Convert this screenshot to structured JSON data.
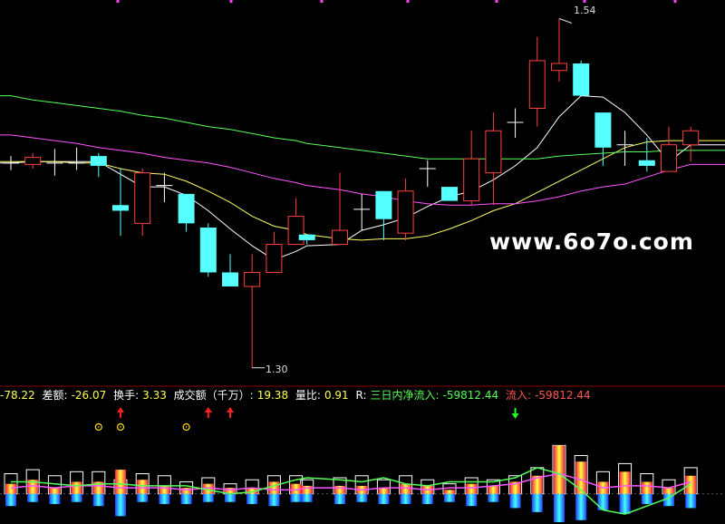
{
  "watermark": "www.6o7o.com",
  "annotations": {
    "high": "1.54",
    "low": "1.30"
  },
  "info_bar": {
    "item0_value": "-78.22",
    "item1_label": "差额:",
    "item1_value": "-26.07",
    "item2_label": "换手:",
    "item2_value": "3.33",
    "item3_label": "成交额（千万）:",
    "item3_value": "19.38",
    "item4_label": "量比:",
    "item4_value": "0.91",
    "item5_label": "R:",
    "item5_text": "三日内净流入:",
    "item5_value": "-59812.44",
    "item6_text": "流入:",
    "item6_value": "-59812.44"
  },
  "colors": {
    "up": "#ff4040",
    "down": "#55ffff",
    "ma5": "#ffffff",
    "ma10": "#ffff66",
    "ma20": "#ff55ff",
    "ma60": "#55ff55",
    "flow_line": "#55ff55",
    "flow_line2": "#ff55ff",
    "buy_arrow": "#ff2020",
    "sell_arrow": "#20ff20",
    "circle": "#ffdd00"
  },
  "chart_data": {
    "type": "candlestick",
    "x": [
      1,
      2,
      3,
      4,
      5,
      6,
      7,
      8,
      9,
      10,
      11,
      12,
      13,
      14,
      14.5,
      16,
      17,
      18,
      19,
      20,
      21,
      22,
      23,
      24,
      25,
      26,
      27,
      28,
      29,
      30,
      31,
      32
    ],
    "candles": [
      {
        "o": 1.447,
        "c": 1.447,
        "h": 1.452,
        "l": 1.442,
        "dir": "flat"
      },
      {
        "o": 1.446,
        "c": 1.451,
        "h": 1.454,
        "l": 1.443,
        "dir": "up"
      },
      {
        "o": 1.447,
        "c": 1.447,
        "h": 1.457,
        "l": 1.438,
        "dir": "flat"
      },
      {
        "o": 1.447,
        "c": 1.447,
        "h": 1.458,
        "l": 1.442,
        "dir": "flat"
      },
      {
        "o": 1.452,
        "c": 1.445,
        "h": 1.454,
        "l": 1.437,
        "dir": "down"
      },
      {
        "o": 1.413,
        "c": 1.417,
        "h": 1.443,
        "l": 1.395,
        "dir": "down"
      },
      {
        "o": 1.404,
        "c": 1.44,
        "h": 1.443,
        "l": 1.395,
        "dir": "up"
      },
      {
        "o": 1.431,
        "c": 1.431,
        "h": 1.44,
        "l": 1.419,
        "dir": "flat"
      },
      {
        "o": 1.425,
        "c": 1.404,
        "h": 1.425,
        "l": 1.398,
        "dir": "down"
      },
      {
        "o": 1.401,
        "c": 1.369,
        "h": 1.404,
        "l": 1.366,
        "dir": "down"
      },
      {
        "o": 1.369,
        "c": 1.359,
        "h": 1.382,
        "l": 1.359,
        "dir": "down"
      },
      {
        "o": 1.359,
        "c": 1.369,
        "h": 1.382,
        "l": 1.301,
        "dir": "up"
      },
      {
        "o": 1.369,
        "c": 1.389,
        "h": 1.398,
        "l": 1.369,
        "dir": "up"
      },
      {
        "o": 1.389,
        "c": 1.409,
        "h": 1.422,
        "l": 1.389,
        "dir": "up"
      },
      {
        "o": 1.396,
        "c": 1.392,
        "h": 1.396,
        "l": 1.389,
        "dir": "down"
      },
      {
        "o": 1.389,
        "c": 1.399,
        "h": 1.44,
        "l": 1.389,
        "dir": "up"
      },
      {
        "o": 1.414,
        "c": 1.414,
        "h": 1.425,
        "l": 1.399,
        "dir": "flat"
      },
      {
        "o": 1.427,
        "c": 1.407,
        "h": 1.427,
        "l": 1.392,
        "dir": "down"
      },
      {
        "o": 1.397,
        "c": 1.427,
        "h": 1.436,
        "l": 1.392,
        "dir": "up"
      },
      {
        "o": 1.443,
        "c": 1.443,
        "h": 1.449,
        "l": 1.43,
        "dir": "flat"
      },
      {
        "o": 1.43,
        "c": 1.42,
        "h": 1.43,
        "l": 1.42,
        "dir": "down"
      },
      {
        "o": 1.42,
        "c": 1.45,
        "h": 1.47,
        "l": 1.417,
        "dir": "up"
      },
      {
        "o": 1.44,
        "c": 1.47,
        "h": 1.483,
        "l": 1.417,
        "dir": "up"
      },
      {
        "o": 1.476,
        "c": 1.476,
        "h": 1.486,
        "l": 1.465,
        "dir": "flat"
      },
      {
        "o": 1.486,
        "c": 1.52,
        "h": 1.537,
        "l": 1.473,
        "dir": "up"
      },
      {
        "o": 1.513,
        "c": 1.518,
        "h": 1.55,
        "l": 1.505,
        "dir": "up"
      },
      {
        "o": 1.518,
        "c": 1.495,
        "h": 1.52,
        "l": 1.495,
        "dir": "down"
      },
      {
        "o": 1.483,
        "c": 1.458,
        "h": 1.483,
        "l": 1.445,
        "dir": "down"
      },
      {
        "o": 1.46,
        "c": 1.46,
        "h": 1.47,
        "l": 1.445,
        "dir": "flat"
      },
      {
        "o": 1.449,
        "c": 1.445,
        "h": 1.465,
        "l": 1.441,
        "dir": "down"
      },
      {
        "o": 1.441,
        "c": 1.46,
        "h": 1.473,
        "l": 1.441,
        "dir": "up"
      },
      {
        "o": 1.46,
        "c": 1.47,
        "h": 1.473,
        "l": 1.448,
        "dir": "up"
      }
    ],
    "moving_averages": [
      {
        "key": "ma5",
        "values": [
          1.447,
          1.448,
          1.448,
          1.448,
          1.448,
          1.439,
          1.43,
          1.43,
          1.424,
          1.413,
          1.4,
          1.388,
          1.378,
          1.384,
          1.388,
          1.389,
          1.399,
          1.403,
          1.408,
          1.416,
          1.423,
          1.427,
          1.435,
          1.445,
          1.458,
          1.48,
          1.495,
          1.494,
          1.483,
          1.467,
          1.448,
          1.46
        ]
      },
      {
        "key": "ma10",
        "values": [
          1.448,
          1.448,
          1.448,
          1.447,
          1.447,
          1.443,
          1.44,
          1.439,
          1.434,
          1.427,
          1.419,
          1.409,
          1.402,
          1.399,
          1.396,
          1.393,
          1.392,
          1.393,
          1.393,
          1.395,
          1.4,
          1.406,
          1.413,
          1.418,
          1.426,
          1.434,
          1.442,
          1.45,
          1.458,
          1.462,
          1.463,
          1.463
        ]
      },
      {
        "key": "ma20",
        "values": [
          1.467,
          1.465,
          1.463,
          1.461,
          1.458,
          1.456,
          1.454,
          1.451,
          1.449,
          1.447,
          1.444,
          1.44,
          1.436,
          1.433,
          1.431,
          1.428,
          1.425,
          1.423,
          1.42,
          1.418,
          1.417,
          1.417,
          1.418,
          1.418,
          1.42,
          1.423,
          1.427,
          1.43,
          1.432,
          1.437,
          1.442,
          1.446
        ]
      },
      {
        "key": "ma60",
        "values": [
          1.495,
          1.492,
          1.49,
          1.488,
          1.486,
          1.484,
          1.481,
          1.479,
          1.476,
          1.473,
          1.471,
          1.468,
          1.465,
          1.463,
          1.461,
          1.458,
          1.456,
          1.454,
          1.452,
          1.45,
          1.45,
          1.45,
          1.45,
          1.45,
          1.45,
          1.452,
          1.453,
          1.454,
          1.455,
          1.455,
          1.456,
          1.456
        ]
      }
    ],
    "price_range": [
      1.295,
      1.56
    ],
    "high_label": "1.54",
    "low_label": "1.30",
    "signals": [
      {
        "x": 5,
        "kind": "circle"
      },
      {
        "x": 6,
        "kind": "buy"
      },
      {
        "x": 6,
        "kind": "circle"
      },
      {
        "x": 9,
        "kind": "circle"
      },
      {
        "x": 10,
        "kind": "buy"
      },
      {
        "x": 11,
        "kind": "buy"
      },
      {
        "x": 24,
        "kind": "sell"
      }
    ],
    "flow": {
      "outline": [
        10,
        12,
        9,
        11,
        11,
        7,
        10,
        9,
        6,
        8,
        5,
        7,
        9,
        9,
        7,
        8,
        9,
        7,
        9,
        7,
        5,
        8,
        7,
        9,
        13,
        24,
        19,
        11,
        15,
        10,
        7,
        13
      ],
      "bar_up": [
        5,
        7,
        3,
        6,
        6,
        12,
        7,
        4,
        3,
        5,
        3,
        3,
        6,
        5,
        4,
        4,
        4,
        3,
        5,
        4,
        2,
        5,
        4,
        6,
        9,
        24,
        16,
        6,
        11,
        6,
        3,
        9
      ],
      "bar_down": [
        6,
        4,
        5,
        4,
        6,
        11,
        4,
        5,
        5,
        4,
        4,
        5,
        6,
        4,
        4,
        5,
        4,
        5,
        5,
        5,
        4,
        6,
        4,
        7,
        9,
        14,
        13,
        8,
        10,
        5,
        6,
        7
      ],
      "line": [
        6,
        6,
        5,
        4,
        5,
        5,
        4,
        4,
        4,
        2,
        0,
        1,
        4,
        7,
        8,
        7,
        6,
        8,
        5,
        4,
        6,
        6,
        6,
        8,
        13,
        10,
        2,
        -8,
        -10,
        -6,
        -2,
        5
      ],
      "line2": [
        3,
        4,
        3,
        4,
        4,
        3,
        3,
        3,
        2,
        3,
        2,
        3,
        2,
        2,
        3,
        3,
        2,
        3,
        3,
        2,
        3,
        3,
        4,
        5,
        8,
        10,
        7,
        3,
        4,
        4,
        3,
        6
      ],
      "range": [
        -14,
        30
      ]
    }
  }
}
